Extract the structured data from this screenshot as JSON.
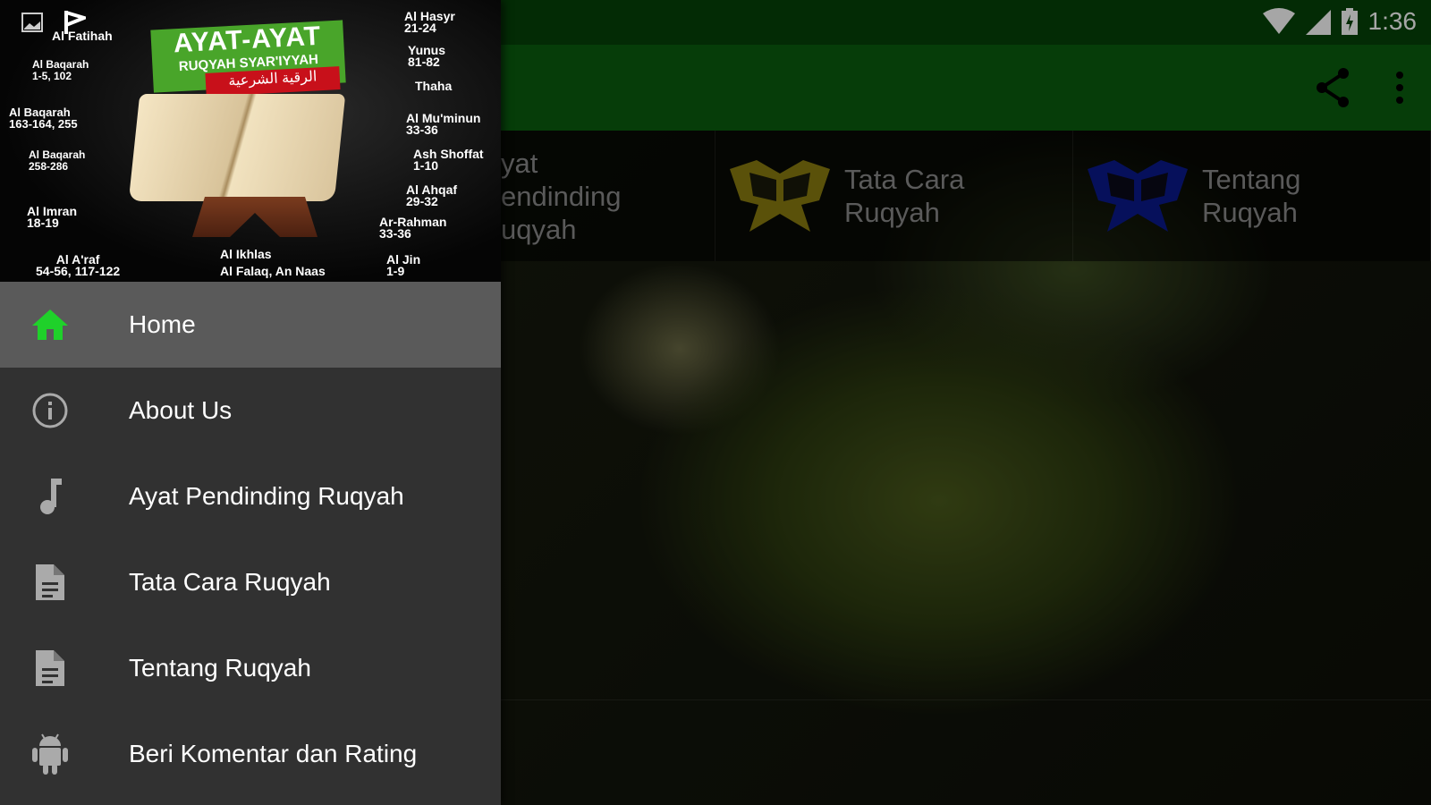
{
  "status_bar": {
    "time": "1:36",
    "icons": [
      "image-icon",
      "check-flag-icon",
      "wifi-icon",
      "signal-icon",
      "battery-charging-icon"
    ]
  },
  "toolbar": {
    "actions": [
      "share-icon",
      "more-vert-icon"
    ]
  },
  "tabs": [
    {
      "label": "Ayat Pendinding Ruqyah",
      "visible_label": "yat\nendinding\nuqyah"
    },
    {
      "label": "Tata Cara\nRuqyah",
      "icon": "quran-icon",
      "color": "#8a7d10"
    },
    {
      "label": "Tentang\nRuqyah",
      "icon": "quran-icon",
      "color": "#0a1a8c"
    }
  ],
  "drawer": {
    "header": {
      "title": "AYAT-AYAT",
      "subtitle": "RUQYAH SYAR'IYYAH",
      "arabic": "الرقية الشرعية",
      "labels": [
        "Al Fatihah",
        "Al Baqarah\n1-5, 102",
        "Al Baqarah\n163-164, 255",
        "Al Baqarah\n258-286",
        "Al Imran\n18-19",
        "Al A'raf\n54-56, 117-122",
        "Al Ikhlas",
        "Al Falaq, An Naas",
        "Al Hasyr\n21-24",
        "Yunus\n81-82",
        "Thaha",
        "Al Mu'minun\n33-36",
        "Ash Shoffat\n1-10",
        "Al Ahqaf\n29-32",
        "Ar-Rahman\n33-36",
        "Al Jin\n1-9"
      ]
    },
    "items": [
      {
        "label": "Home",
        "icon": "home-icon",
        "active": true
      },
      {
        "label": "About Us",
        "icon": "info-icon"
      },
      {
        "label": "Ayat Pendinding Ruqyah",
        "icon": "music-note-icon"
      },
      {
        "label": "Tata Cara Ruqyah",
        "icon": "document-icon"
      },
      {
        "label": "Tentang Ruqyah",
        "icon": "document-icon"
      },
      {
        "label": "Beri Komentar dan Rating",
        "icon": "android-icon"
      }
    ]
  },
  "colors": {
    "status_bar": "#054209",
    "toolbar": "#0a5f0e",
    "home_icon": "#1fd12a",
    "drawer": "#313131"
  }
}
